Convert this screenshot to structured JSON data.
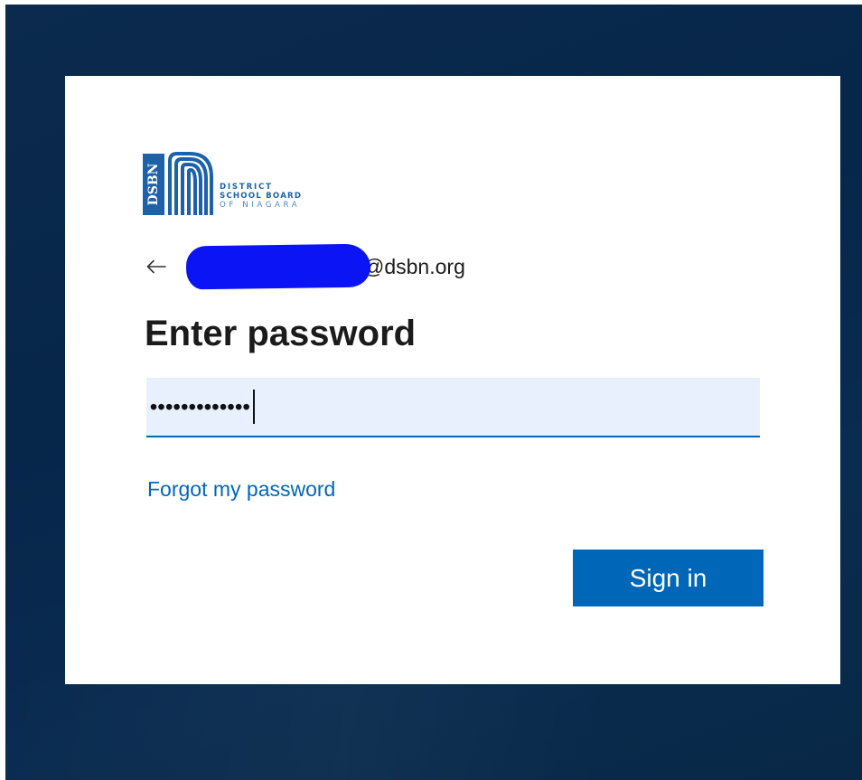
{
  "organization": {
    "logo_monogram": "DSBN",
    "name_line1": "DISTRICT",
    "name_line2": "SCHOOL BOARD",
    "name_line3": "OF NIAGARA",
    "brand_color": "#1d62a8"
  },
  "identity": {
    "back_icon": "arrow-left-icon",
    "email_domain": "@dsbn.org",
    "redaction_color": "#0b14f5"
  },
  "form": {
    "title": "Enter password",
    "password_masked": "•••••••••••••",
    "forgot_link": "Forgot my password",
    "submit_label": "Sign in"
  },
  "colors": {
    "accent": "#0067b8",
    "input_fill": "#e8f0fe",
    "background": "#0b2a4d"
  }
}
